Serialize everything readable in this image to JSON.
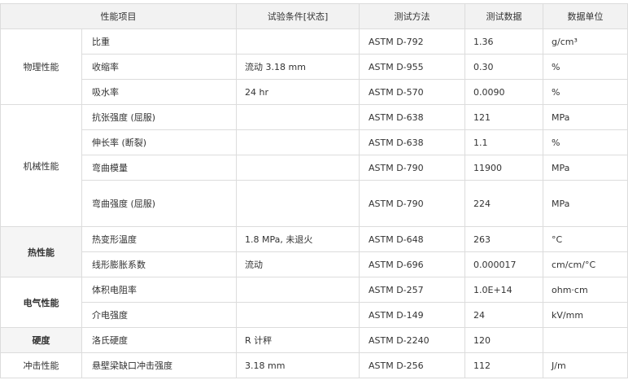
{
  "headers": [
    "性能项目",
    "试验条件[状态]",
    "测试方法",
    "测试数据",
    "数据单位"
  ],
  "groups": [
    {
      "category": "物理性能",
      "bold": false,
      "shade": false,
      "rows": [
        {
          "property": "比重",
          "condition": "",
          "method": "ASTM D-792",
          "value": "1.36",
          "unit": "g/cm³",
          "h": 31
        },
        {
          "property": "收缩率",
          "condition": "流动 3.18 mm",
          "method": "ASTM D-955",
          "value": "0.30",
          "unit": "%",
          "h": 31
        },
        {
          "property": "吸水率",
          "condition": "24 hr",
          "method": "ASTM D-570",
          "value": "0.0090",
          "unit": "%",
          "h": 31
        }
      ]
    },
    {
      "category": "机械性能",
      "bold": false,
      "shade": false,
      "rows": [
        {
          "property": "抗张强度 (屈服)",
          "condition": "",
          "method": "ASTM D-638",
          "value": "121",
          "unit": "MPa",
          "h": 31
        },
        {
          "property": "伸长率 (断裂)",
          "condition": "",
          "method": "ASTM D-638",
          "value": "1.1",
          "unit": "%",
          "h": 31
        },
        {
          "property": "弯曲模量",
          "condition": "",
          "method": "ASTM D-790",
          "value": "11900",
          "unit": "MPa",
          "h": 31
        },
        {
          "property": "弯曲强度 (屈服)",
          "condition": "",
          "method": "ASTM D-790",
          "value": "224",
          "unit": "MPa",
          "h": 57
        }
      ]
    },
    {
      "category": "热性能",
      "bold": true,
      "shade": true,
      "rows": [
        {
          "property": "热变形温度",
          "condition": "1.8 MPa, 未退火",
          "method": "ASTM D-648",
          "value": "263",
          "unit": "°C",
          "h": 31
        },
        {
          "property": "线形膨胀系数",
          "condition": "流动",
          "method": "ASTM D-696",
          "value": "0.000017",
          "unit": "cm/cm/°C",
          "h": 31
        }
      ]
    },
    {
      "category": "电气性能",
      "bold": true,
      "shade": false,
      "rows": [
        {
          "property": "体积电阻率",
          "condition": "",
          "method": "ASTM D-257",
          "value": "1.0E+14",
          "unit": "ohm·cm",
          "h": 31
        },
        {
          "property": "介电强度",
          "condition": "",
          "method": "ASTM D-149",
          "value": "24",
          "unit": "kV/mm",
          "h": 31
        }
      ]
    },
    {
      "category": "硬度",
      "bold": true,
      "shade": true,
      "rows": [
        {
          "property": "洛氏硬度",
          "condition": "R 计秤",
          "method": "ASTM D-2240",
          "value": "120",
          "unit": "",
          "h": 31
        }
      ]
    },
    {
      "category": "冲击性能",
      "bold": false,
      "shade": false,
      "rows": [
        {
          "property": "悬壁梁缺口冲击强度",
          "condition": "3.18 mm",
          "method": "ASTM D-256",
          "value": "112",
          "unit": "J/m",
          "h": 31
        }
      ]
    }
  ]
}
